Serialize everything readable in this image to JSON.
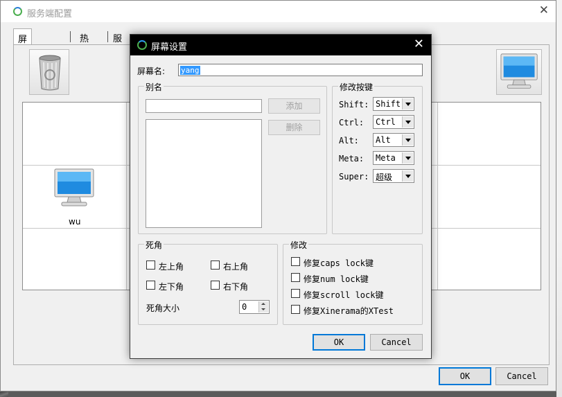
{
  "main_window": {
    "title": "服务端配置",
    "close_glyph": "✕",
    "tabs": [
      {
        "label": "屏幕和联接"
      },
      {
        "label": "热键"
      },
      {
        "label": "服务端高级设置"
      }
    ],
    "grid_screen": {
      "name": "wu"
    },
    "ok_label": "OK",
    "cancel_label": "Cancel"
  },
  "dialog": {
    "title": "屏幕设置",
    "close_glyph": "✕",
    "screen_name_label": "屏幕名:",
    "screen_name_value": "yang",
    "aliases": {
      "title": "别名",
      "add_label": "添加",
      "remove_label": "删除"
    },
    "modifiers": {
      "title": "修改按键",
      "rows": [
        {
          "label": "Shift:",
          "value": "Shift"
        },
        {
          "label": "Ctrl:",
          "value": "Ctrl"
        },
        {
          "label": "Alt:",
          "value": "Alt"
        },
        {
          "label": "Meta:",
          "value": "Meta"
        },
        {
          "label": "Super:",
          "value": "超级"
        }
      ]
    },
    "dead_corners": {
      "title": "死角",
      "top_left": "左上角",
      "top_right": "右上角",
      "bottom_left": "左下角",
      "bottom_right": "右下角",
      "size_label": "死角大小",
      "size_value": "0"
    },
    "fixes": {
      "title": "修改",
      "caps": "修复caps lock键",
      "num": "修复num lock键",
      "scroll": "修复scroll lock键",
      "xtest": "修复Xinerama的XTest"
    },
    "ok_label": "OK",
    "cancel_label": "Cancel"
  },
  "colors": {
    "selection": "#3399ff",
    "default_button_border": "#0078d7",
    "dialog_titlebar": "#000000"
  }
}
